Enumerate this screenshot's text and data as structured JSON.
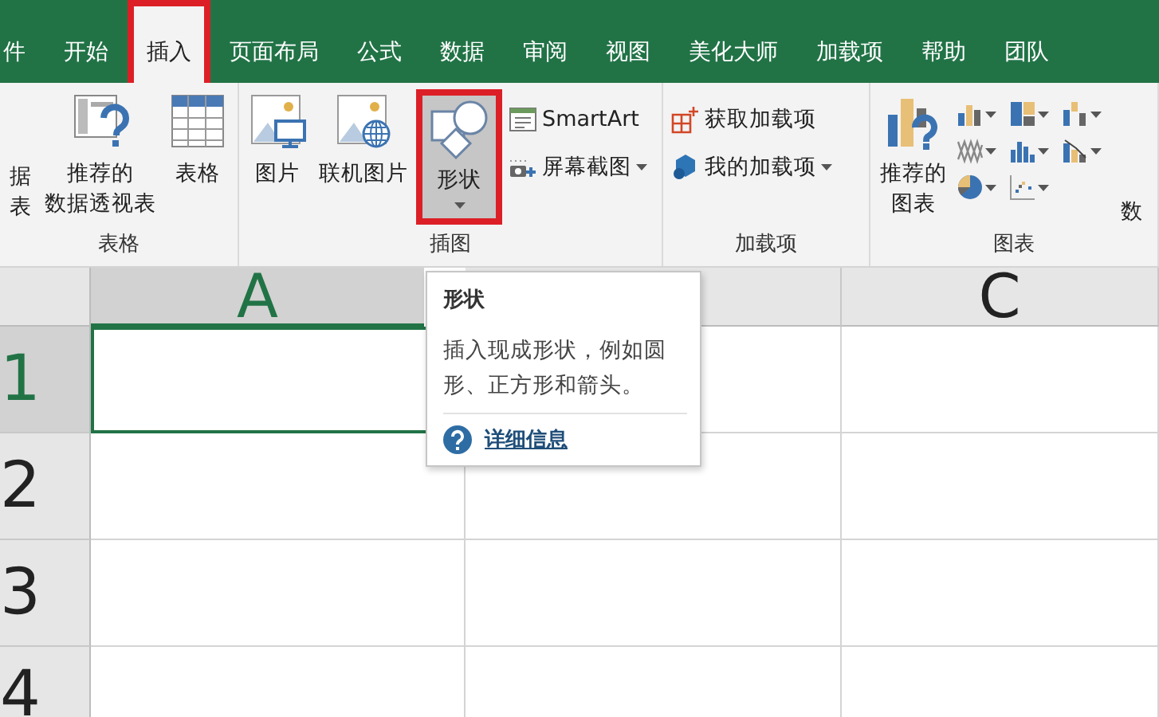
{
  "tabs": [
    {
      "label": "件",
      "selected": false,
      "highlighted": false
    },
    {
      "label": "开始",
      "selected": false,
      "highlighted": false
    },
    {
      "label": "插入",
      "selected": true,
      "highlighted": true
    },
    {
      "label": "页面布局",
      "selected": false,
      "highlighted": false
    },
    {
      "label": "公式",
      "selected": false,
      "highlighted": false
    },
    {
      "label": "数据",
      "selected": false,
      "highlighted": false
    },
    {
      "label": "审阅",
      "selected": false,
      "highlighted": false
    },
    {
      "label": "视图",
      "selected": false,
      "highlighted": false
    },
    {
      "label": "美化大师",
      "selected": false,
      "highlighted": false
    },
    {
      "label": "加载项",
      "selected": false,
      "highlighted": false
    },
    {
      "label": "帮助",
      "selected": false,
      "highlighted": false
    },
    {
      "label": "团队",
      "selected": false,
      "highlighted": false
    }
  ],
  "ribbon": {
    "groups": [
      {
        "label": "表格",
        "items": [
          {
            "kind": "large",
            "lines": [
              "据",
              "表"
            ],
            "dropdown": false,
            "hovered": false,
            "highlighted": false
          },
          {
            "kind": "large",
            "lines": [
              "推荐的",
              "数据透视表"
            ],
            "dropdown": false,
            "hovered": false,
            "highlighted": false
          },
          {
            "kind": "large",
            "lines": [
              "表格"
            ],
            "dropdown": false,
            "hovered": false,
            "highlighted": false
          }
        ]
      },
      {
        "label": "插图",
        "items": [
          {
            "kind": "large",
            "lines": [
              "图片"
            ],
            "dropdown": false,
            "hovered": false,
            "highlighted": false
          },
          {
            "kind": "large",
            "lines": [
              "联机图片"
            ],
            "dropdown": false,
            "hovered": false,
            "highlighted": false
          },
          {
            "kind": "large",
            "lines": [
              "形状"
            ],
            "dropdown": true,
            "hovered": true,
            "highlighted": true
          },
          {
            "kind": "stack",
            "entries": [
              {
                "label": "SmartArt",
                "dropdown": false
              },
              {
                "label": "屏幕截图",
                "dropdown": true
              }
            ]
          }
        ]
      },
      {
        "label": "加载项",
        "items": [
          {
            "kind": "stack",
            "entries": [
              {
                "label": "获取加载项",
                "dropdown": false
              },
              {
                "label": "我的加载项",
                "dropdown": true
              }
            ]
          }
        ]
      },
      {
        "label": "图表",
        "items": [
          {
            "kind": "large",
            "lines": [
              "推荐的",
              "图表"
            ],
            "dropdown": false,
            "hovered": false,
            "highlighted": false
          },
          {
            "kind": "gallery",
            "buttons": [
              {
                "dropdown": true
              },
              {
                "dropdown": true
              },
              {
                "dropdown": true
              },
              {
                "dropdown": true
              },
              {
                "dropdown": true
              },
              {
                "dropdown": true
              },
              {
                "dropdown": true
              },
              {
                "dropdown": true
              }
            ]
          },
          {
            "kind": "large",
            "lines": [
              "数"
            ],
            "dropdown": false,
            "hovered": false,
            "highlighted": false
          }
        ]
      }
    ]
  },
  "tooltip": {
    "title": "形状",
    "description": "插入现成形状，例如圆形、正方形和箭头。",
    "link": "详细信息"
  },
  "grid": {
    "columns": [
      {
        "label": "A",
        "selected": true
      },
      {
        "selected": false
      },
      {
        "label": "C",
        "selected": false
      }
    ],
    "rows": [
      {
        "label": "1",
        "selected": true
      },
      {
        "label": "2",
        "selected": false
      },
      {
        "label": "3",
        "selected": false
      },
      {
        "label": "4",
        "selected": false
      }
    ]
  }
}
